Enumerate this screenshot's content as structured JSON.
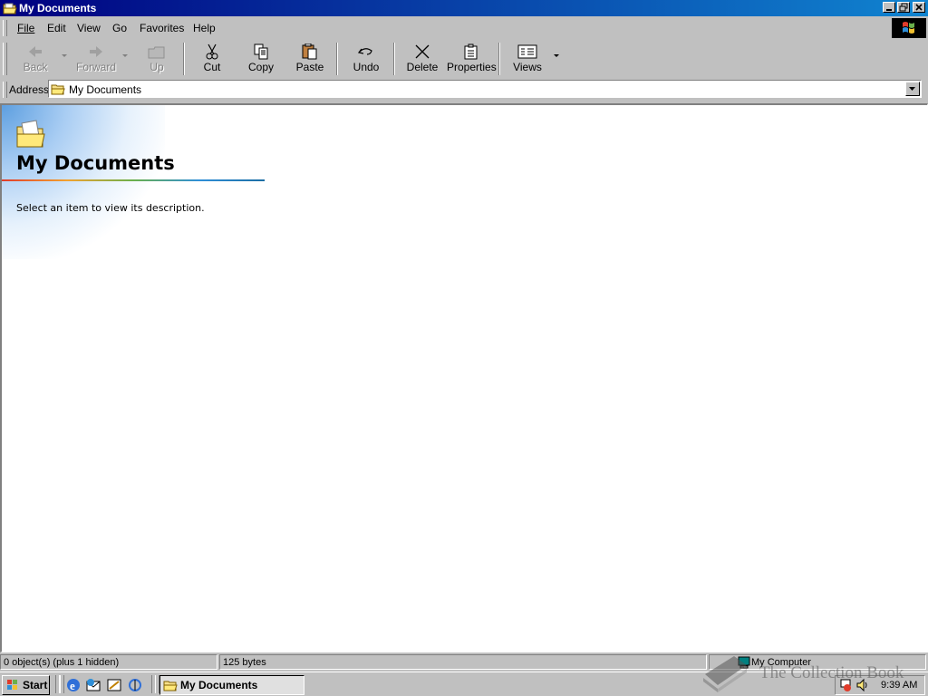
{
  "window": {
    "title": "My Documents"
  },
  "menu": {
    "file": "File",
    "edit": "Edit",
    "view": "View",
    "go": "Go",
    "favorites": "Favorites",
    "help": "Help"
  },
  "toolbar": {
    "back": "Back",
    "forward": "Forward",
    "up": "Up",
    "cut": "Cut",
    "copy": "Copy",
    "paste": "Paste",
    "undo": "Undo",
    "delete": "Delete",
    "properties": "Properties",
    "views": "Views"
  },
  "address": {
    "label": "Address",
    "value": "My Documents"
  },
  "content": {
    "heading": "My Documents",
    "description": "Select an item to view its description."
  },
  "statusbar": {
    "objects": "0 object(s) (plus 1 hidden)",
    "size": "125 bytes",
    "zone": "My Computer"
  },
  "taskbar": {
    "start": "Start",
    "task": "My Documents",
    "clock": "9:39 AM"
  },
  "watermark": {
    "text": "The Collection Book"
  },
  "icons": [
    "folder-icon",
    "minimize-icon",
    "maximize-icon",
    "close-icon",
    "windows-logo-icon",
    "back-icon",
    "forward-icon",
    "up-icon",
    "cut-icon",
    "copy-icon",
    "paste-icon",
    "undo-icon",
    "delete-icon",
    "properties-icon",
    "views-icon",
    "dropdown-icon",
    "start-logo-icon",
    "ie-icon",
    "outlook-icon",
    "desktop-icon",
    "channels-icon",
    "computer-icon",
    "volume-icon",
    "tray-network-icon",
    "book-icon"
  ],
  "colors": {
    "titlebar_start": "#000080",
    "titlebar_end": "#1084d0",
    "face": "#c0c0c0"
  }
}
